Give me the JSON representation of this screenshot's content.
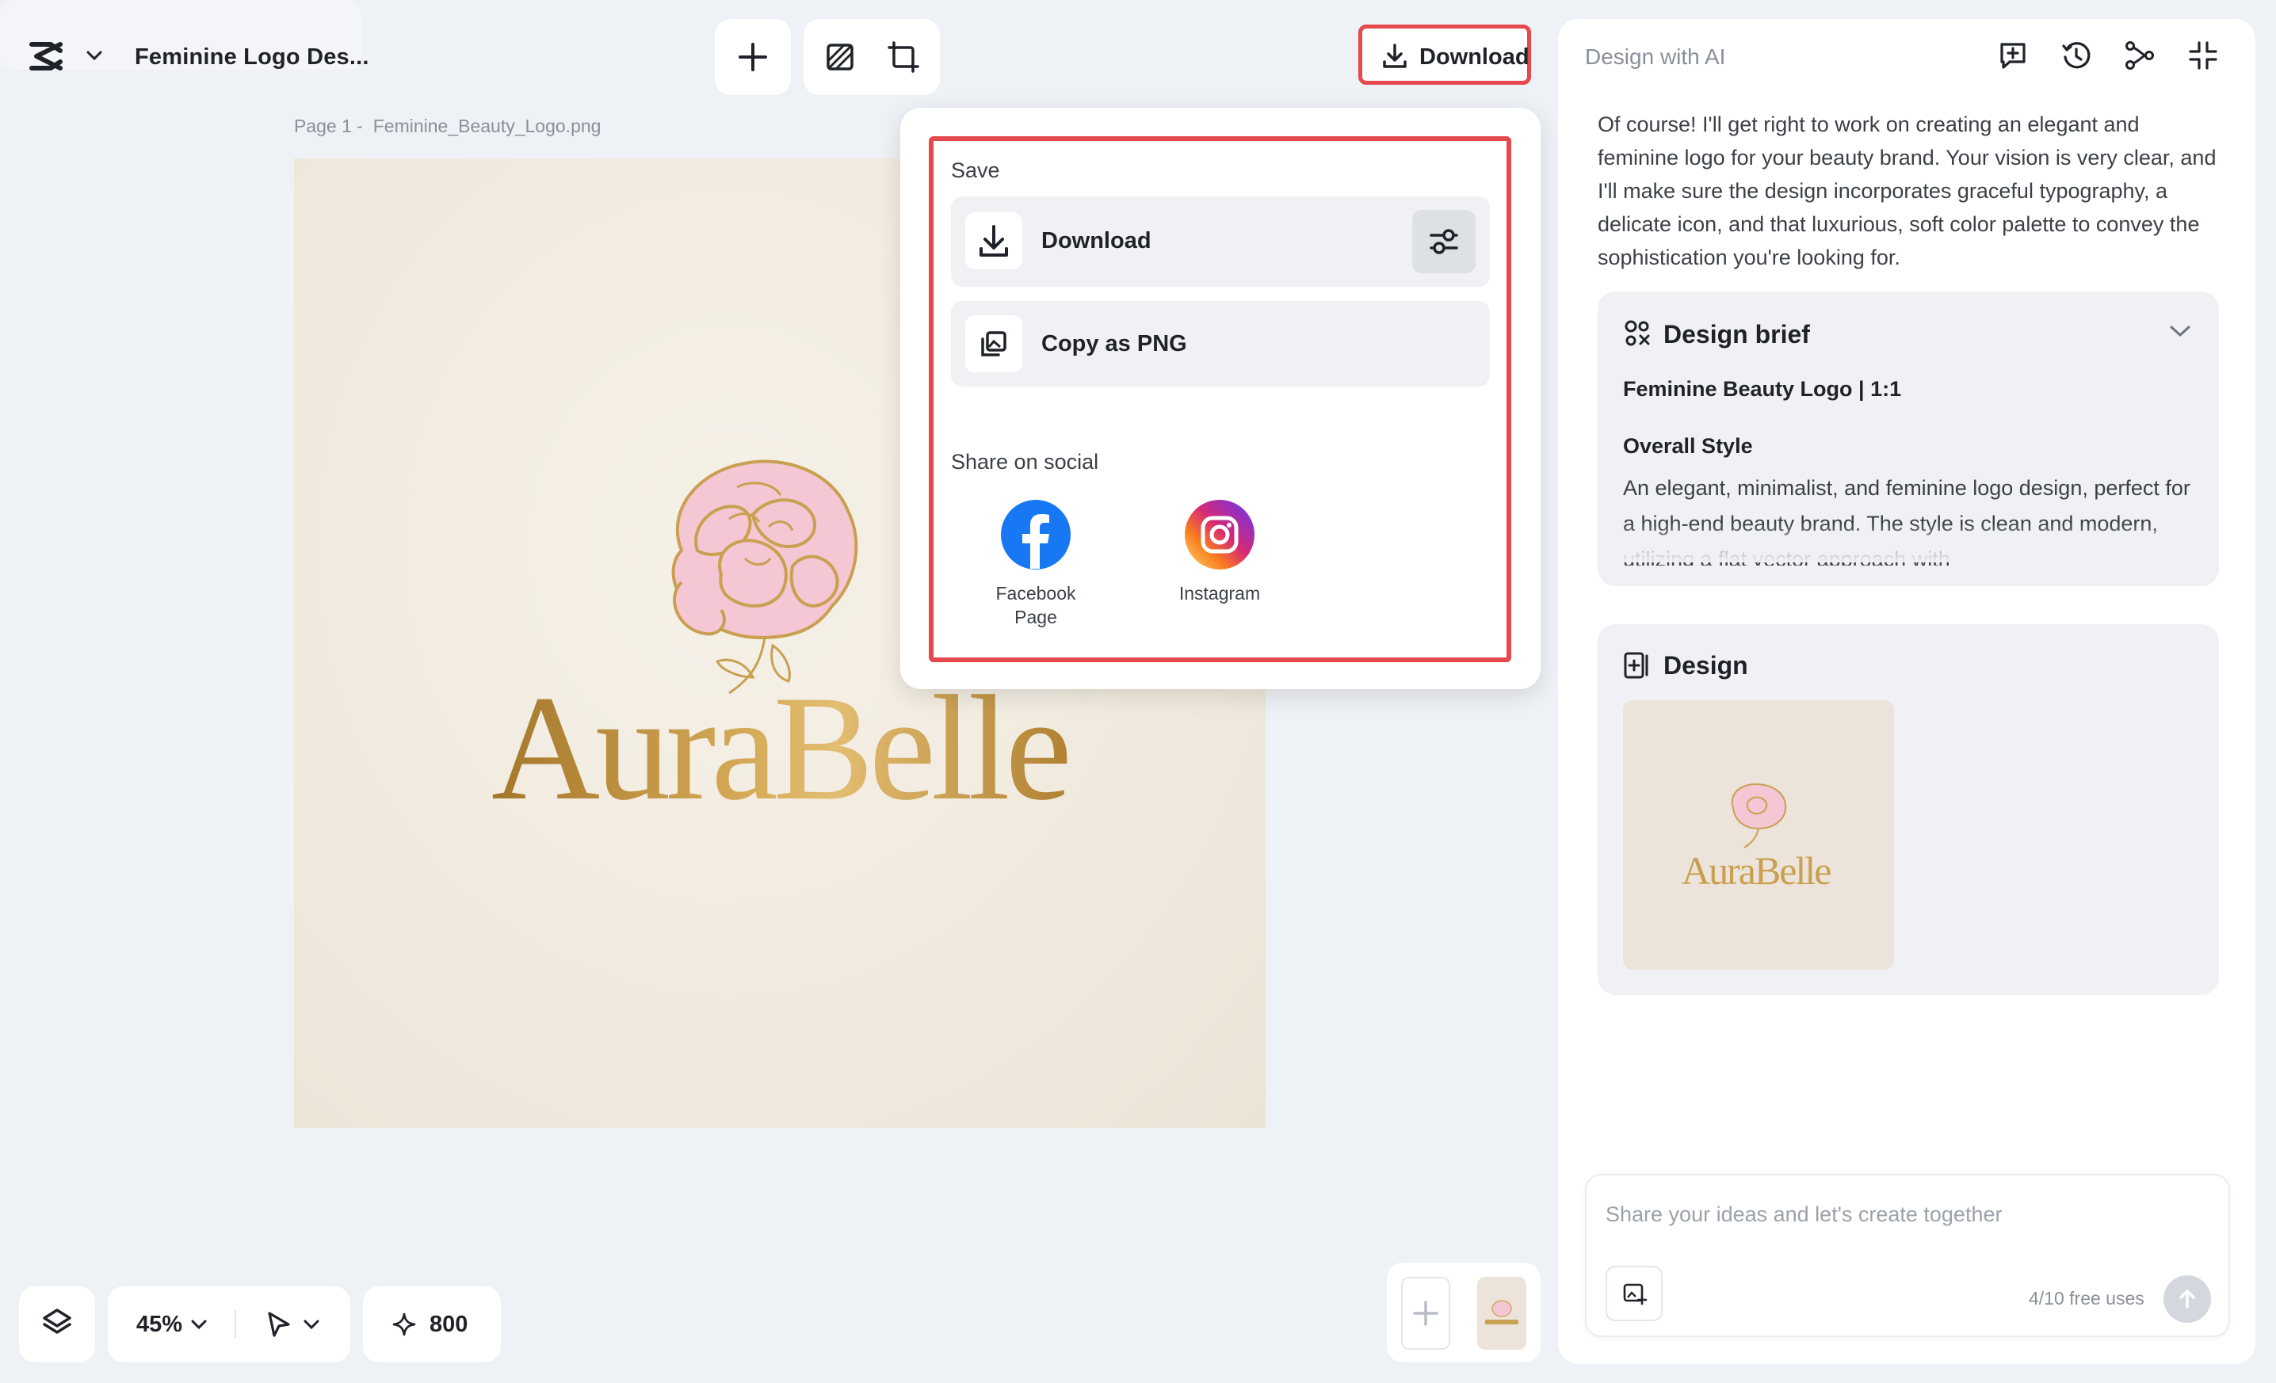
{
  "header": {
    "project_title": "Feminine Logo Des..."
  },
  "page": {
    "label": "Page 1 -",
    "filename": "Feminine_Beauty_Logo.png"
  },
  "canvas": {
    "logo_text": "AuraBelle"
  },
  "toolbar": {
    "download_label": "Download"
  },
  "download_menu": {
    "save_heading": "Save",
    "download_label": "Download",
    "copy_png_label": "Copy as PNG",
    "share_heading": "Share on social",
    "facebook_label_line1": "Facebook",
    "facebook_label_line2": "Page",
    "instagram_label": "Instagram"
  },
  "right_panel": {
    "title": "Design with AI",
    "ai_message": "Of course! I'll get right to work on creating an elegant and feminine logo for your beauty brand. Your vision is very clear, and I'll make sure the design incorporates graceful typography, a delicate icon, and that luxurious, soft color palette to convey the sophistication you're looking for.",
    "brief": {
      "heading": "Design brief",
      "subtitle": "Feminine Beauty Logo | 1:1",
      "style_heading": "Overall Style",
      "style_text": "An elegant, minimalist, and feminine logo design, perfect for a high-end beauty brand. The style is clean and modern, utilizing a flat vector approach with"
    },
    "design": {
      "heading": "Design",
      "thumb_text": "AuraBelle"
    },
    "prompt": {
      "placeholder": "Share your ideas and let's create together",
      "free_uses": "4/10 free uses"
    }
  },
  "bottom_bar": {
    "zoom": "45%",
    "credits": "800"
  },
  "colors": {
    "highlight": "#e5484d",
    "facebook": "#1877f2",
    "logo_gold": "#c9a050",
    "logo_pink": "#f5c6d3"
  }
}
